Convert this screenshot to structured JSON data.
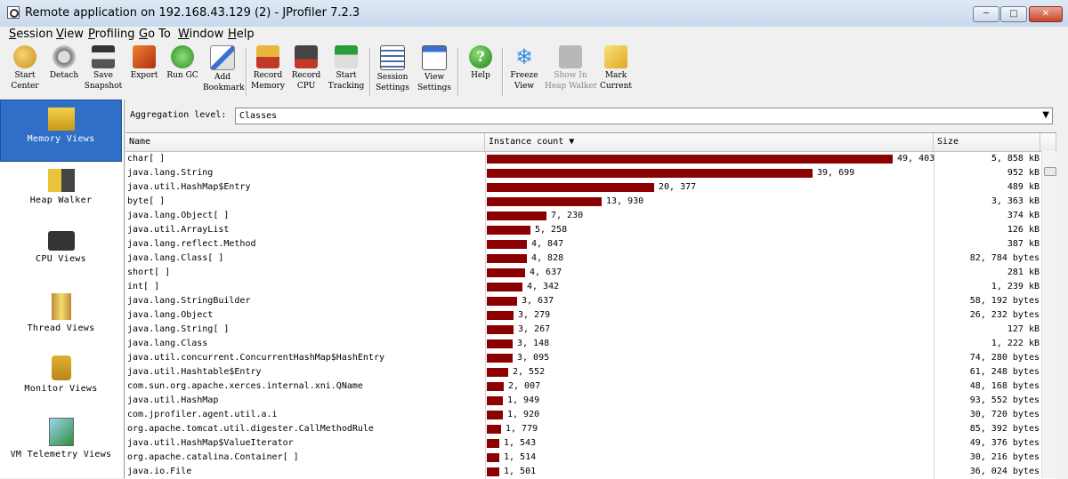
{
  "window": {
    "title": "Remote application on 192.168.43.129 (2) - JProfiler 7.2.3",
    "min": "─",
    "max": "□",
    "close": "✕"
  },
  "menu": [
    "Session",
    "View",
    "Profiling",
    "Go To",
    "Window",
    "Help"
  ],
  "toolbar": [
    {
      "label": "Start\nCenter",
      "icon": "start-center-icon"
    },
    {
      "label": "Detach",
      "icon": "detach-icon"
    },
    {
      "label": "Save\nSnapshot",
      "icon": "save-icon"
    },
    {
      "label": "Export",
      "icon": "export-icon"
    },
    {
      "label": "Run GC",
      "icon": "gc-icon"
    },
    {
      "label": "Add\nBookmark",
      "icon": "bookmark-icon"
    },
    {
      "label": "Record\nMemory",
      "icon": "record-memory-icon"
    },
    {
      "label": "Record\nCPU",
      "icon": "record-cpu-icon"
    },
    {
      "label": "Start\nTracking",
      "icon": "tracking-icon"
    },
    {
      "label": "Session\nSettings",
      "icon": "session-settings-icon"
    },
    {
      "label": "View\nSettings",
      "icon": "view-settings-icon"
    },
    {
      "label": "Help",
      "icon": "help-icon"
    },
    {
      "label": "Freeze\nView",
      "icon": "freeze-icon"
    },
    {
      "label": "Show In\nHeap Walker",
      "icon": "heap-walker-icon",
      "disabled": true
    },
    {
      "label": "Mark\nCurrent",
      "icon": "mark-icon"
    }
  ],
  "nav": [
    {
      "label": "Memory Views",
      "icon": "memory-views-icon",
      "active": true
    },
    {
      "label": "Heap Walker",
      "icon": "heap-walker-icon"
    },
    {
      "label": "CPU Views",
      "icon": "cpu-chip-icon"
    },
    {
      "label": "Thread Views",
      "icon": "thread-spool-icon"
    },
    {
      "label": "Monitor Views",
      "icon": "lock-icon"
    },
    {
      "label": "VM Telemetry Views",
      "icon": "telemetry-chart-icon"
    }
  ],
  "aggregation": {
    "label": "Aggregation level:",
    "value": "Classes",
    "arrow": "▼"
  },
  "table": {
    "columns": {
      "name": "Name",
      "count": "Instance count ▼",
      "size": "Size"
    },
    "max_count": 49403,
    "rows": [
      {
        "name": "char[ ]",
        "count": 49403,
        "count_text": "49, 403",
        "size": "5, 858  kB"
      },
      {
        "name": "java.lang.String",
        "count": 39699,
        "count_text": "39, 699",
        "size": "952  kB"
      },
      {
        "name": "java.util.HashMap$Entry",
        "count": 20377,
        "count_text": "20, 377",
        "size": "489  kB"
      },
      {
        "name": "byte[ ]",
        "count": 13930,
        "count_text": "13, 930",
        "size": "3, 363  kB"
      },
      {
        "name": "java.lang.Object[ ]",
        "count": 7230,
        "count_text": "7, 230",
        "size": "374  kB"
      },
      {
        "name": "java.util.ArrayList",
        "count": 5258,
        "count_text": "5, 258",
        "size": "126  kB"
      },
      {
        "name": "java.lang.reflect.Method",
        "count": 4847,
        "count_text": "4, 847",
        "size": "387  kB"
      },
      {
        "name": "java.lang.Class[ ]",
        "count": 4828,
        "count_text": "4, 828",
        "size": "82, 784  bytes"
      },
      {
        "name": "short[ ]",
        "count": 4637,
        "count_text": "4, 637",
        "size": "281  kB"
      },
      {
        "name": "int[ ]",
        "count": 4342,
        "count_text": "4, 342",
        "size": "1, 239  kB"
      },
      {
        "name": "java.lang.StringBuilder",
        "count": 3637,
        "count_text": "3, 637",
        "size": "58, 192  bytes"
      },
      {
        "name": "java.lang.Object",
        "count": 3279,
        "count_text": "3, 279",
        "size": "26, 232  bytes"
      },
      {
        "name": "java.lang.String[ ]",
        "count": 3267,
        "count_text": "3, 267",
        "size": "127  kB"
      },
      {
        "name": "java.lang.Class",
        "count": 3148,
        "count_text": "3, 148",
        "size": "1, 222  kB"
      },
      {
        "name": "java.util.concurrent.ConcurrentHashMap$HashEntry",
        "count": 3095,
        "count_text": "3, 095",
        "size": "74, 280  bytes"
      },
      {
        "name": "java.util.Hashtable$Entry",
        "count": 2552,
        "count_text": "2, 552",
        "size": "61, 248  bytes"
      },
      {
        "name": "com.sun.org.apache.xerces.internal.xni.QName",
        "count": 2007,
        "count_text": "2, 007",
        "size": "48, 168  bytes"
      },
      {
        "name": "java.util.HashMap",
        "count": 1949,
        "count_text": "1, 949",
        "size": "93, 552  bytes"
      },
      {
        "name": "com.jprofiler.agent.util.a.i",
        "count": 1920,
        "count_text": "1, 920",
        "size": "30, 720  bytes"
      },
      {
        "name": "org.apache.tomcat.util.digester.CallMethodRule",
        "count": 1779,
        "count_text": "1, 779",
        "size": "85, 392  bytes"
      },
      {
        "name": "java.util.HashMap$ValueIterator",
        "count": 1543,
        "count_text": "1, 543",
        "size": "49, 376  bytes"
      },
      {
        "name": "org.apache.catalina.Container[ ]",
        "count": 1514,
        "count_text": "1, 514",
        "size": "30, 216  bytes"
      },
      {
        "name": "java.io.File",
        "count": 1501,
        "count_text": "1, 501",
        "size": "36, 024  bytes"
      }
    ]
  }
}
